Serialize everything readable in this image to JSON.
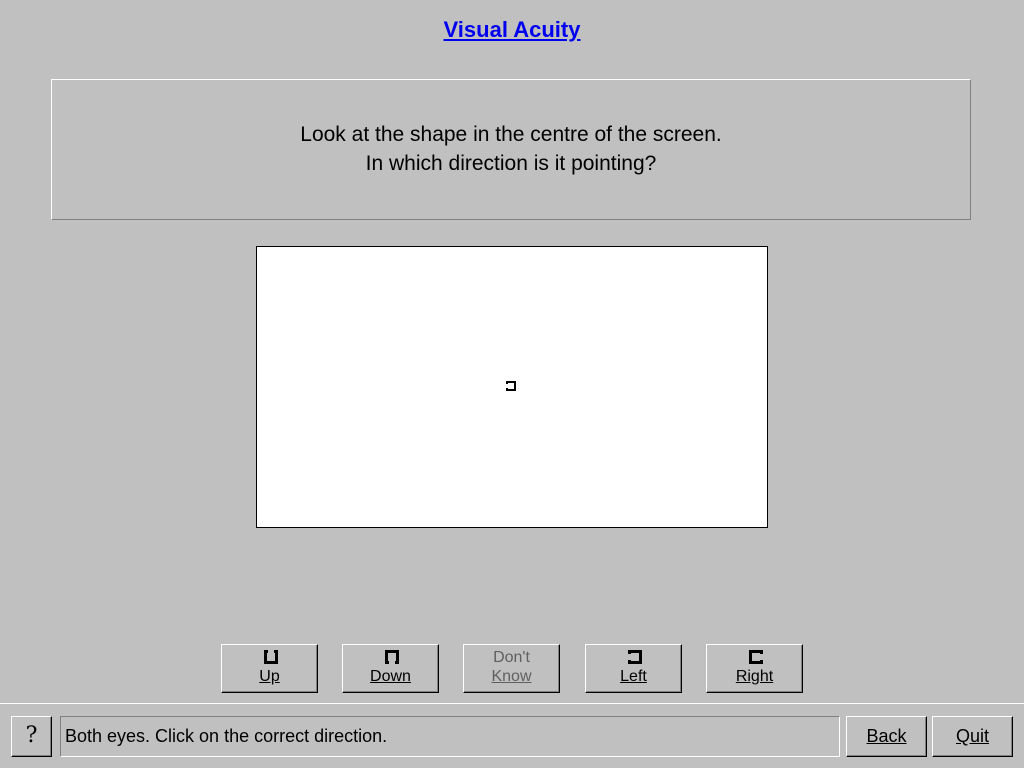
{
  "page": {
    "title": "Visual Acuity"
  },
  "instructions": {
    "line1": "Look at the shape in the centre of the screen.",
    "line2": "In which direction is it pointing?"
  },
  "stimulus": {
    "optotype_icon": "c-optotype-icon",
    "optotype_orientation": "left"
  },
  "direction_buttons": {
    "up": {
      "label": "Up",
      "icon": "c-up-icon"
    },
    "down": {
      "label": "Down",
      "icon": "c-down-icon"
    },
    "dont_know": {
      "line1": "Don't",
      "line2": "Know"
    },
    "left": {
      "label": "Left",
      "icon": "c-left-icon"
    },
    "right": {
      "label": "Right",
      "icon": "c-right-icon"
    }
  },
  "statusbar": {
    "help_icon": "question-mark-icon",
    "message": "Both eyes. Click on the correct direction.",
    "back_label": "Back",
    "quit_label": "Quit"
  }
}
